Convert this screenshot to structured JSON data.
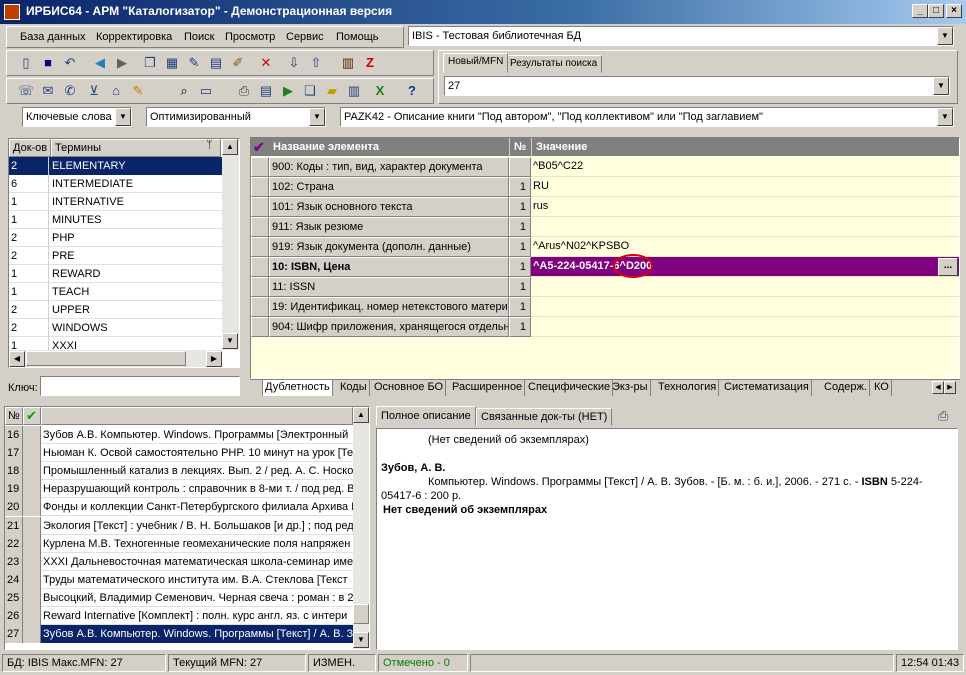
{
  "title": "ИРБИС64 - АРМ \"Каталогизатор\" - Демонстрационная версия",
  "menu": [
    "База данных",
    "Корректировка",
    "Поиск",
    "Просмотр",
    "Сервис",
    "Помощь"
  ],
  "db_combo": "IBIS - Тестовая библиотечная БД",
  "mfn_tabs": [
    "Новый/MFN",
    "Результаты поиска"
  ],
  "mfn_value": "27",
  "filters": {
    "search_type": "Ключевые слова",
    "mode": "Оптимизированный",
    "worksheet": "PAZK42 - Описание книги \"Под автором\", \"Под коллективом\" или \"Под заглавием\""
  },
  "dict": {
    "headers": [
      "Док-ов",
      "Термины"
    ],
    "rows": [
      {
        "count": "2",
        "term": "ELEMENTARY"
      },
      {
        "count": "6",
        "term": "INTERMEDIATE"
      },
      {
        "count": "1",
        "term": "INTERNATIVE"
      },
      {
        "count": "1",
        "term": "MINUTES"
      },
      {
        "count": "2",
        "term": "PHP"
      },
      {
        "count": "2",
        "term": "PRE"
      },
      {
        "count": "1",
        "term": "REWARD"
      },
      {
        "count": "1",
        "term": "TEACH"
      },
      {
        "count": "2",
        "term": "UPPER"
      },
      {
        "count": "2",
        "term": "WINDOWS"
      },
      {
        "count": "1",
        "term": "XXXI"
      }
    ],
    "key_label": "Ключ:"
  },
  "fields": {
    "headers": {
      "name": "Название элемента",
      "num": "№",
      "value": "Значение"
    },
    "rows": [
      {
        "name": "900: Коды : тип, вид, характер документа",
        "num": "",
        "value": "^B05^C22",
        "bold": false
      },
      {
        "name": "102: Страна",
        "num": "1",
        "value": "RU",
        "bold": false
      },
      {
        "name": "101: Язык основного текста",
        "num": "1",
        "value": "rus",
        "bold": false
      },
      {
        "name": "911: Язык резюме",
        "num": "1",
        "value": "",
        "bold": false
      },
      {
        "name": "919: Язык документа (дополн. данные)",
        "num": "1",
        "value": "^Arus^N02^KPSBO",
        "bold": false
      },
      {
        "name": "10: ISBN, Цена",
        "num": "1",
        "value": "^A5-224-05417-6^D200",
        "bold": true
      },
      {
        "name": "11: ISSN",
        "num": "1",
        "value": "",
        "bold": false
      },
      {
        "name": "19: Идентификац. номер нетекстового материала",
        "num": "1",
        "value": "",
        "bold": false
      },
      {
        "name": "904: Шифр приложения, хранящегося отдельно",
        "num": "1",
        "value": "",
        "bold": false
      }
    ],
    "ellipsis": "...",
    "tabs": [
      "Дублетность",
      "Коды",
      "Основное БО",
      "Расширенное",
      "Специфические",
      "Экз-ры",
      "Технология",
      "Систематизация",
      "Содерж.",
      "КО"
    ]
  },
  "records": {
    "headers": [
      "№"
    ],
    "rows": [
      {
        "n": "16",
        "text": "Зубов А.В. Компьютер. Windows. Программы [Электронный"
      },
      {
        "n": "17",
        "text": "Ньюман К. Освой самостоятельно PHP. 10 минут на урок [Те"
      },
      {
        "n": "18",
        "text": "Промышленный катализ в лекциях. Вып. 2 / ред. А. С. Носко"
      },
      {
        "n": "19",
        "text": "Неразрушающий контроль : справочник в 8-ми т. / под ред. В"
      },
      {
        "n": "20",
        "text": "Фонды и коллекции Санкт-Петербургского филиала Архива Р"
      },
      {
        "n": "21",
        "text": "Экология [Текст] : учебник / В. Н. Большаков [и др.] ; под ред"
      },
      {
        "n": "22",
        "text": "Курлена М.В. Техногенные геомеханические поля напряжен"
      },
      {
        "n": "23",
        "text": "XXXI Дальневосточная математическая школа-семинар име"
      },
      {
        "n": "24",
        "text": "Труды математического института им. В.А. Стеклова [Текст"
      },
      {
        "n": "25",
        "text": "Высоцкий, Владимир Семенович. Черная свеча : роман : в 2"
      },
      {
        "n": "26",
        "text": "Reward Internative [Комплект] : полн. курс англ. яз. с интери"
      },
      {
        "n": "27",
        "text": "Зубов А.В. Компьютер. Windows. Программы [Текст] / А. В. З"
      }
    ]
  },
  "description": {
    "tabs": [
      "Полное описание",
      "Связанные док-ты (НЕТ)"
    ],
    "line1": "(Нет сведений об экземплярах)",
    "author": "Зубов, А. В.",
    "body_a": "Компьютер. Windows. Программы [Текст] / А. В. Зубов. - [Б. м. : б. и.], 2006. - 271 с. - ",
    "isbn_label": "ISBN",
    "body_b": " 5-224-",
    "body_c": "05417-6 : 200 р.",
    "no_copies": "Нет сведений об экземплярах"
  },
  "status": {
    "db": "БД: IBIS Макс.MFN: 27",
    "current": "Текущий MFN: 27",
    "changed": "ИЗМЕН.",
    "marked": "Отмечено - 0",
    "time": "12:54 01:43"
  }
}
